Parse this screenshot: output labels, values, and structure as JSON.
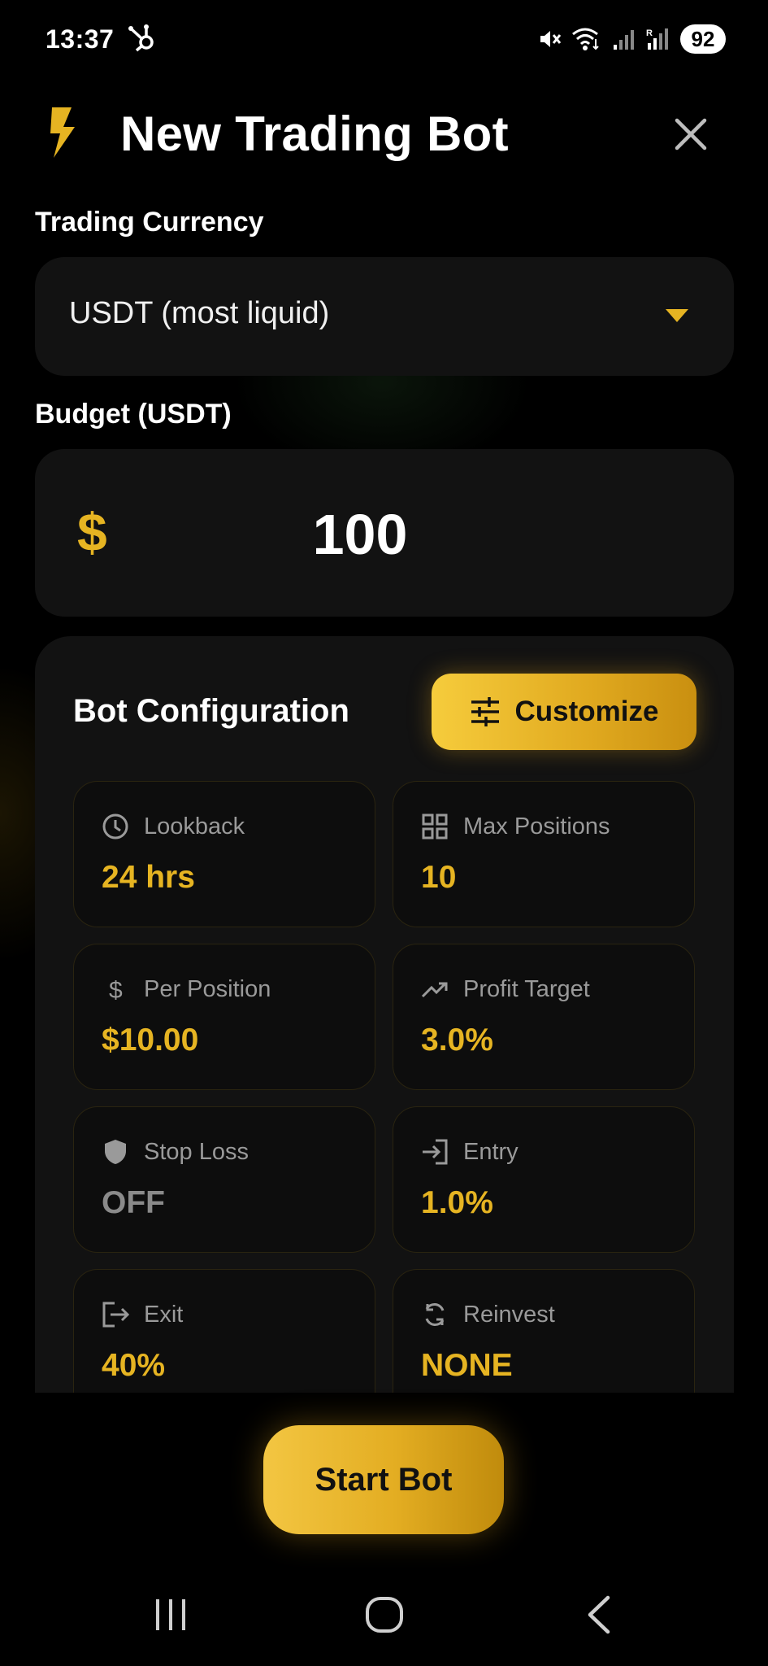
{
  "status_bar": {
    "time": "13:37",
    "battery": "92"
  },
  "header": {
    "title": "New Trading Bot",
    "icon": "lightning-bolt-icon"
  },
  "currency": {
    "label": "Trading Currency",
    "selected": "USDT (most liquid)"
  },
  "budget": {
    "label": "Budget (USDT)",
    "symbol": "$",
    "value": "100"
  },
  "config": {
    "title": "Bot Configuration",
    "customize_label": "Customize",
    "items": [
      {
        "label": "Lookback",
        "value": "24 hrs",
        "icon": "clock-icon"
      },
      {
        "label": "Max Positions",
        "value": "10",
        "icon": "grid-icon"
      },
      {
        "label": "Per Position",
        "value": "$10.00",
        "icon": "dollar-icon"
      },
      {
        "label": "Profit Target",
        "value": "3.0%",
        "icon": "trending-up-icon"
      },
      {
        "label": "Stop Loss",
        "value": "OFF",
        "icon": "shield-icon"
      },
      {
        "label": "Entry",
        "value": "1.0%",
        "icon": "login-icon"
      },
      {
        "label": "Exit",
        "value": "40%",
        "icon": "logout-icon"
      },
      {
        "label": "Reinvest",
        "value": "NONE",
        "icon": "sync-icon"
      }
    ]
  },
  "actions": {
    "start_label": "Start Bot"
  },
  "colors": {
    "accent": "#e6b422",
    "background": "#000000",
    "card": "#121212"
  }
}
